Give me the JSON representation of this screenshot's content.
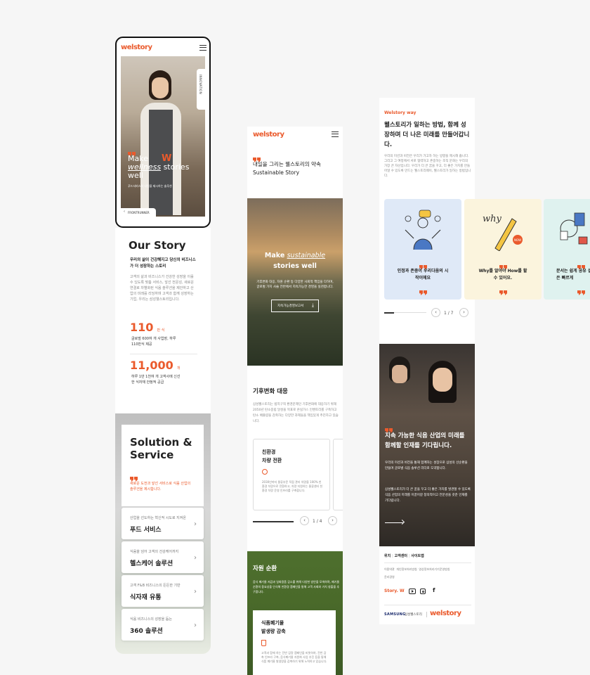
{
  "phone1": {
    "logo": "welstory",
    "side_tab": "INNOVATION",
    "hero_title_line1": "Make",
    "hero_title_italic": "wellness",
    "hero_title_rest": "stories",
    "hero_title_line3": "well",
    "hero_sub": "푸드서비스의 내일을 제시하는 솔루션",
    "bottom_tab": "FRONTRUNNER"
  },
  "story": {
    "title": "Our Story",
    "lead": "우리의 삶이 건강해지고 당신의 비즈니스가 더 성장하는 스토리",
    "body": "고객의 삶과 비즈니스가 건강한 성장을 이룰 수 있도록 맞춤 서비스, 앞선 전문성, 새로운 연결로 차별화된 식음 솔루션을 제안하고 산업의 미래를 리딩하며 고객과 함께 성장하는 기업, 우리는 삼성웰스토리입니다.",
    "stat1_value": "110",
    "stat1_unit": "만 식",
    "stat1_desc": "글로벌 600여 개 사업장, 하루 110만식 제공",
    "stat2_value": "11,000",
    "stat2_unit": "개",
    "stat2_desc": "하루 1만 1천여 개 고객사에 신선한 식자재 안정적 공급"
  },
  "solution": {
    "title_line1": "Solution &",
    "title_line2": "Service",
    "desc": "새로운 도전과 앞선 서비스로 식음 산업의 솔루션을 제시합니다.",
    "cards": [
      {
        "sub": "산업을 선도하는 혁신적 시도로 지켜온",
        "title": "푸드 서비스"
      },
      {
        "sub": "식음을 넘어 고객의 건강케어까지",
        "title": "헬스케어 솔루션"
      },
      {
        "sub": "고객 F&B 비즈니스의 든든한 기반",
        "title": "식자재 유통"
      },
      {
        "sub": "식음 비즈니스의 성장을 돕는",
        "title": "360 솔루션"
      }
    ]
  },
  "phone2": {
    "logo": "welstory",
    "heading_line1": "내일을 그리는 웰스토리의 약속",
    "heading_line2": "Sustainable Story",
    "hero_make": "Make",
    "hero_italic": "sustainable",
    "hero_line2": "stories well",
    "hero_desc": "기후변화 대응, 자원 순환 등 다양한 사회적 책임을 다하며, 글로벌 가치 사슬 전반에서 지속가능한 경영을 실천합니다.",
    "hero_button": "지속가능경영보고서",
    "climate_title": "기후변화 대응",
    "climate_desc": "삼성웰스토리는 범지구적 환경문제인 기후변화에 대응하기 위해 2050년 탄소중립 달성을 목표로 온실가스 인벤토리를 구축하고 탄소 배출량을 감축하는 다양한 과제들을 책임있게 추진하고 있습니다.",
    "card_title_line1": "친환경",
    "card_title_line2": "차량 전환",
    "card_desc": "2030년까지 물류부문 직접 관리 차량을 100% 친환경 차량으로 전환하고, 차량 지원하는 물류센터 친환경 차량 운영 인프라를 구축합니다.",
    "pager": "1 / 4",
    "resource_title": "자원 순환",
    "resource_desc": "음식 폐기물 저감과 일회용품 감소를 위해 다양한 방안을 모색하며, 폐기물 순환의 중요성을 인식해 친환경 캠페인을 통해 고객 사회와 가치 창출을 추구합니다.",
    "card2_title_line1": "식품폐기물",
    "card2_title_line2": "발생량 감축",
    "card2_desc": "고객과 함께 하는 잔반 감량 캠페인을 비롯하여, 잔반 감축 인프라 구축, 음식폐기물 자원화 사업 추진 등을 통해 식품 폐기물 발생량을 감축하기 위해 노력하고 있습니다."
  },
  "phone3": {
    "eyebrow": "Welstory way",
    "heading": "웰스토리가 일하는 방법, 함께 성장하며 더 나은 미래를 만들어갑니다.",
    "desc": "우리의 미션과 비전은 우리가 가고자 하는 방향을 제시해 줍니다. 그리고 그 여정에서 서로 협력하고 존중하는 조직 문화는 우리의 가장 큰 자산입니다. 우리가 더 큰 꿈을 꾸고, 더 좋은 가치를 만들어낼 수 있도록 만드는 웰스토리웨이, 웰스토리가 일하는 방법입니다.",
    "way_cards": [
      {
        "text": "인정과 존중이 우리다움의 시작이에요",
        "color": "#dfe9f7"
      },
      {
        "text": "Why를 알아야 How를 할 수 있어요.",
        "color": "#fbf4dd"
      },
      {
        "text": "문서는 쉽게 공유 실행은 빠르게",
        "color": "#dff2ef"
      }
    ],
    "pager": "1 / 7",
    "recruit_title": "지속 가능한 식음 산업의 미래를 함께할 인재를 기다립니다.",
    "recruit_desc1": "우리의 미션과 비전을 통해 함께하는 성장으로 삼성의 선순환을 만들며 글로벌 식음 솔루션 리더로 도약합니다.",
    "recruit_desc2": "삼성웰스토리가 더 큰 꿈을 꾸고 더 좋은 가치를 발견할 수 있도록 식음 산업의 미래를 이끌어갈 창의적이고 전문성을 갖춘 인재를 기다립니다.",
    "footer_links": [
      "위치",
      "고객센터",
      "사이트맵"
    ],
    "footer_sub1": [
      "이용약관",
      "개인정보처리방침",
      "영상정보처리기기운영방침"
    ],
    "footer_sub2": "윤리경영",
    "story_w": "Story. W",
    "samsung": "SAMSUNG",
    "samsung_kr": "삼성웰스토리",
    "footer_logo": "welstory"
  },
  "colors": {
    "accent": "#ea5a2c",
    "background": "#f6f6f6"
  }
}
